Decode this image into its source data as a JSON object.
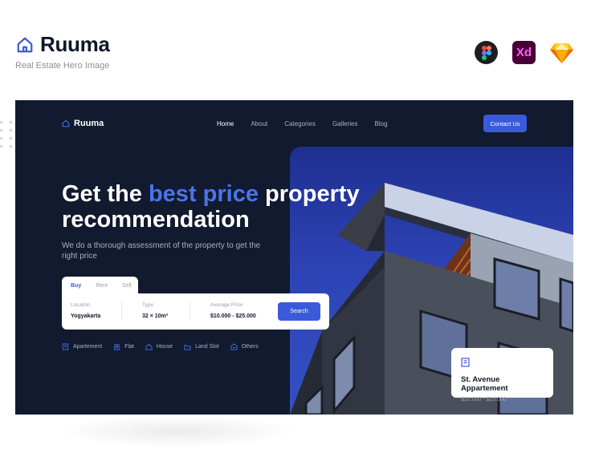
{
  "brand": {
    "name": "Ruuma",
    "subtitle": "Real Estate Hero Image"
  },
  "tools": [
    "figma-icon",
    "xd-icon",
    "sketch-icon"
  ],
  "tool_xd_label": "Xd",
  "hero": {
    "nav": {
      "logo": "Ruuma",
      "links": [
        "Home",
        "About",
        "Categories",
        "Galleries",
        "Blog"
      ],
      "active": "Home",
      "contact": "Contact Us"
    },
    "headline": {
      "part1": "Get the ",
      "highlight": "best price",
      "part2": " property recommendation"
    },
    "subtext": "We do a thorough assessment of the property to get the right price",
    "tabs": [
      "Buy",
      "Rent",
      "Sell"
    ],
    "search": {
      "location_label": "Location",
      "location_value": "Yogyakarta",
      "type_label": "Type",
      "type_value": "32 × 10m²",
      "price_label": "Average Price",
      "price_value": "$10.000 - $25.000",
      "button": "Search"
    },
    "categories": [
      "Apartement",
      "Flat",
      "House",
      "Land Slot",
      "Others"
    ],
    "card": {
      "title": "St. Avenue Appartement",
      "price": "$10.000 - $25.000"
    }
  },
  "colors": {
    "accent": "#3a5bd9",
    "highlight": "#4a74e8",
    "hero_bg": "#111a2e"
  }
}
